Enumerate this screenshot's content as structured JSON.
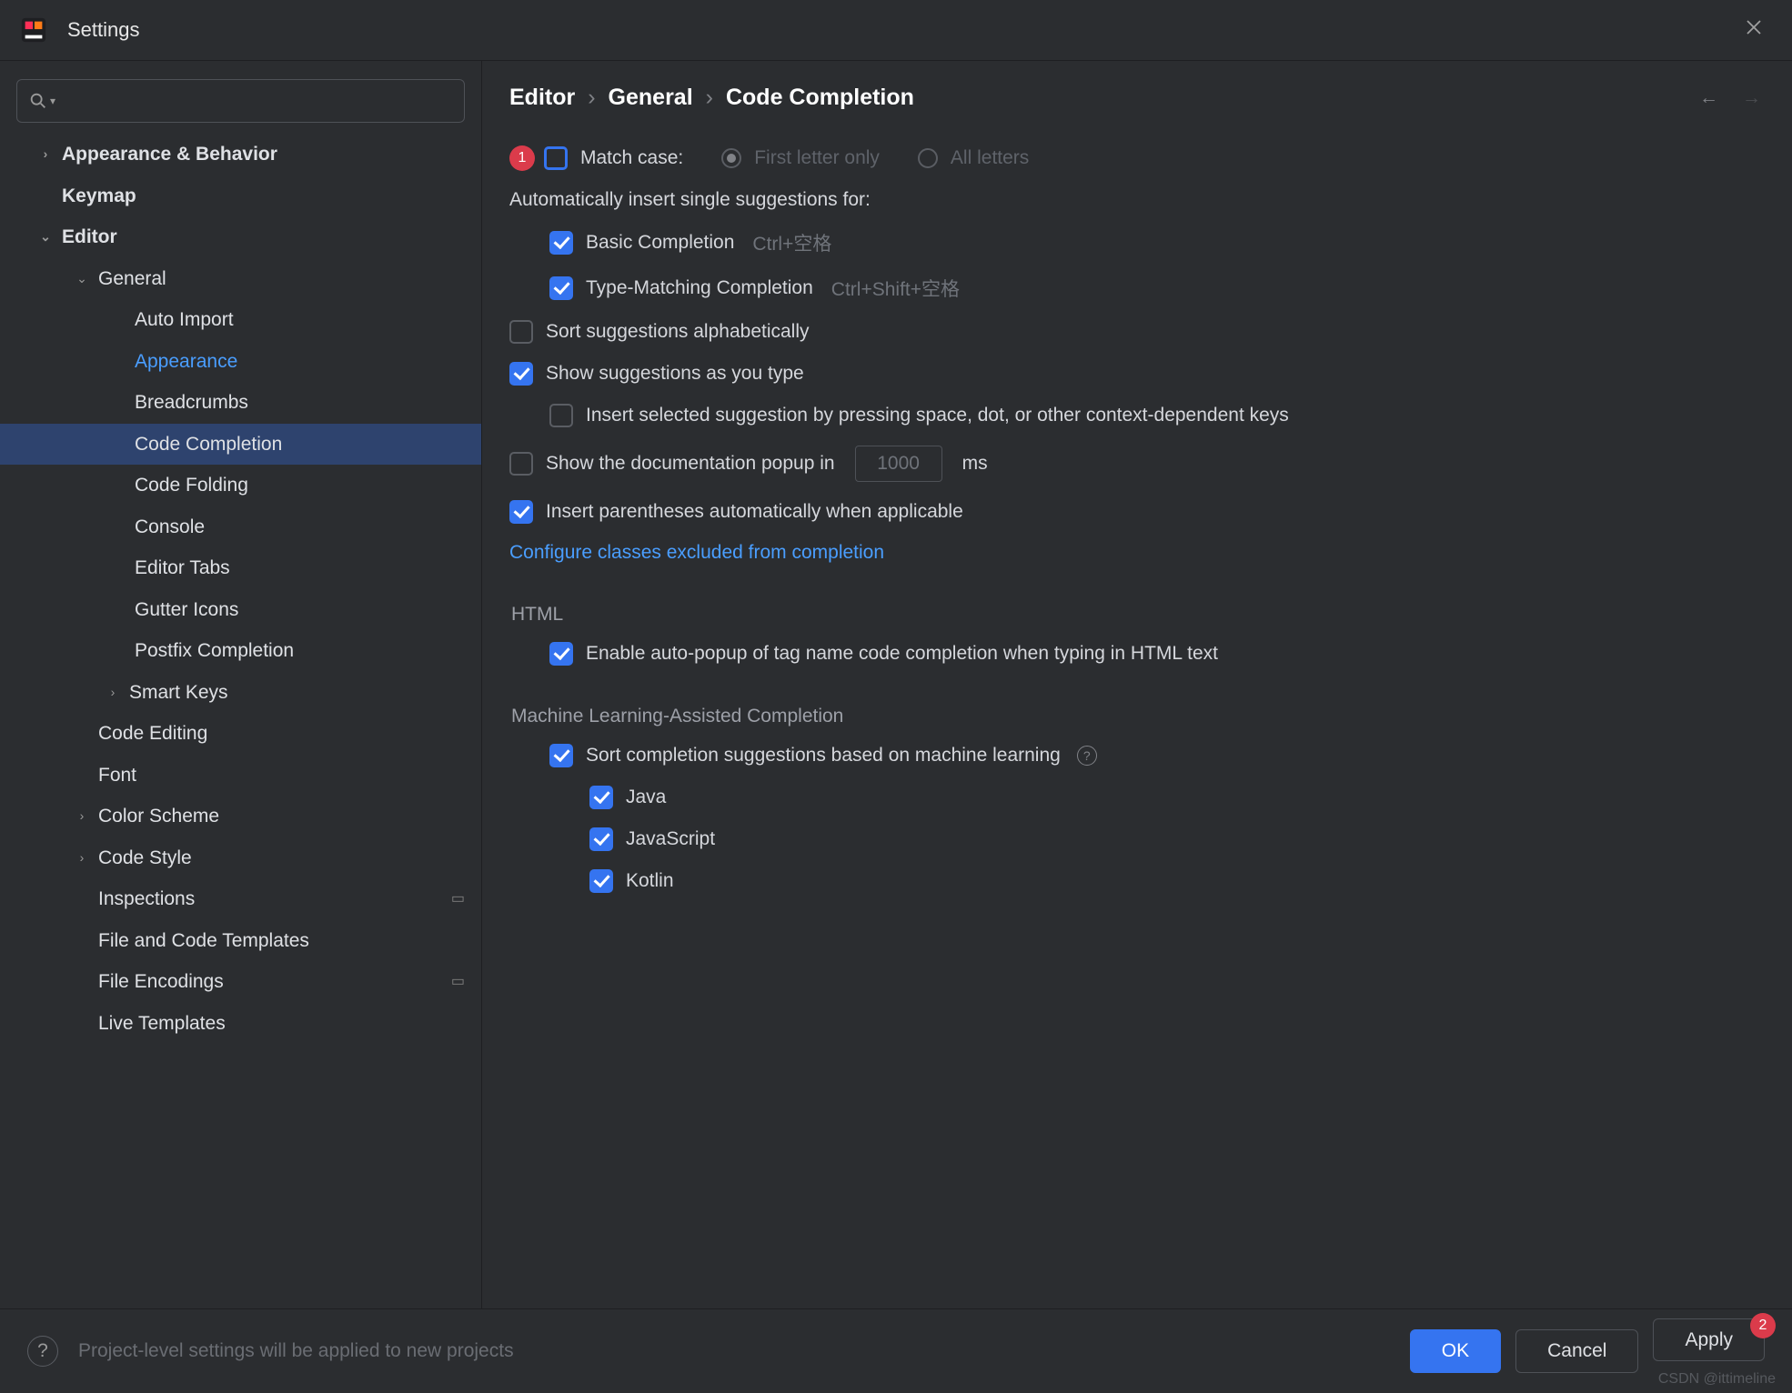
{
  "title": "Settings",
  "search": {
    "placeholder": ""
  },
  "markers": {
    "one": "1",
    "two": "2"
  },
  "sidebar": {
    "appearance_behavior": "Appearance & Behavior",
    "keymap": "Keymap",
    "editor": "Editor",
    "general": "General",
    "auto_import": "Auto Import",
    "appearance": "Appearance",
    "breadcrumbs": "Breadcrumbs",
    "code_completion": "Code Completion",
    "code_folding": "Code Folding",
    "console": "Console",
    "editor_tabs": "Editor Tabs",
    "gutter_icons": "Gutter Icons",
    "postfix_completion": "Postfix Completion",
    "smart_keys": "Smart Keys",
    "code_editing": "Code Editing",
    "font": "Font",
    "color_scheme": "Color Scheme",
    "code_style": "Code Style",
    "inspections": "Inspections",
    "file_code_templates": "File and Code Templates",
    "file_encodings": "File Encodings",
    "live_templates": "Live Templates"
  },
  "breadcrumb": {
    "a": "Editor",
    "b": "General",
    "c": "Code Completion",
    "sep": "›"
  },
  "options": {
    "match_case": "Match case:",
    "first_letter": "First letter only",
    "all_letters": "All letters",
    "auto_insert_label": "Automatically insert single suggestions for:",
    "basic_completion": "Basic Completion",
    "basic_shortcut": "Ctrl+空格",
    "type_matching": "Type-Matching Completion",
    "type_shortcut": "Ctrl+Shift+空格",
    "sort_alpha": "Sort suggestions alphabetically",
    "as_you_type": "Show suggestions as you type",
    "insert_selected": "Insert selected suggestion by pressing space, dot, or other context-dependent keys",
    "show_doc_prefix": "Show the documentation popup in",
    "show_doc_value": "1000",
    "show_doc_suffix": "ms",
    "insert_parens": "Insert parentheses automatically when applicable",
    "configure_link": "Configure classes excluded from completion",
    "html_section": "HTML",
    "html_enable": "Enable auto-popup of tag name code completion when typing in HTML text",
    "ml_section": "Machine Learning-Assisted Completion",
    "ml_sort": "Sort completion suggestions based on machine learning",
    "ml_java": "Java",
    "ml_js": "JavaScript",
    "ml_kotlin": "Kotlin"
  },
  "footer": {
    "hint": "Project-level settings will be applied to new projects",
    "ok": "OK",
    "cancel": "Cancel",
    "apply": "Apply"
  },
  "watermark": "CSDN @ittimeline"
}
